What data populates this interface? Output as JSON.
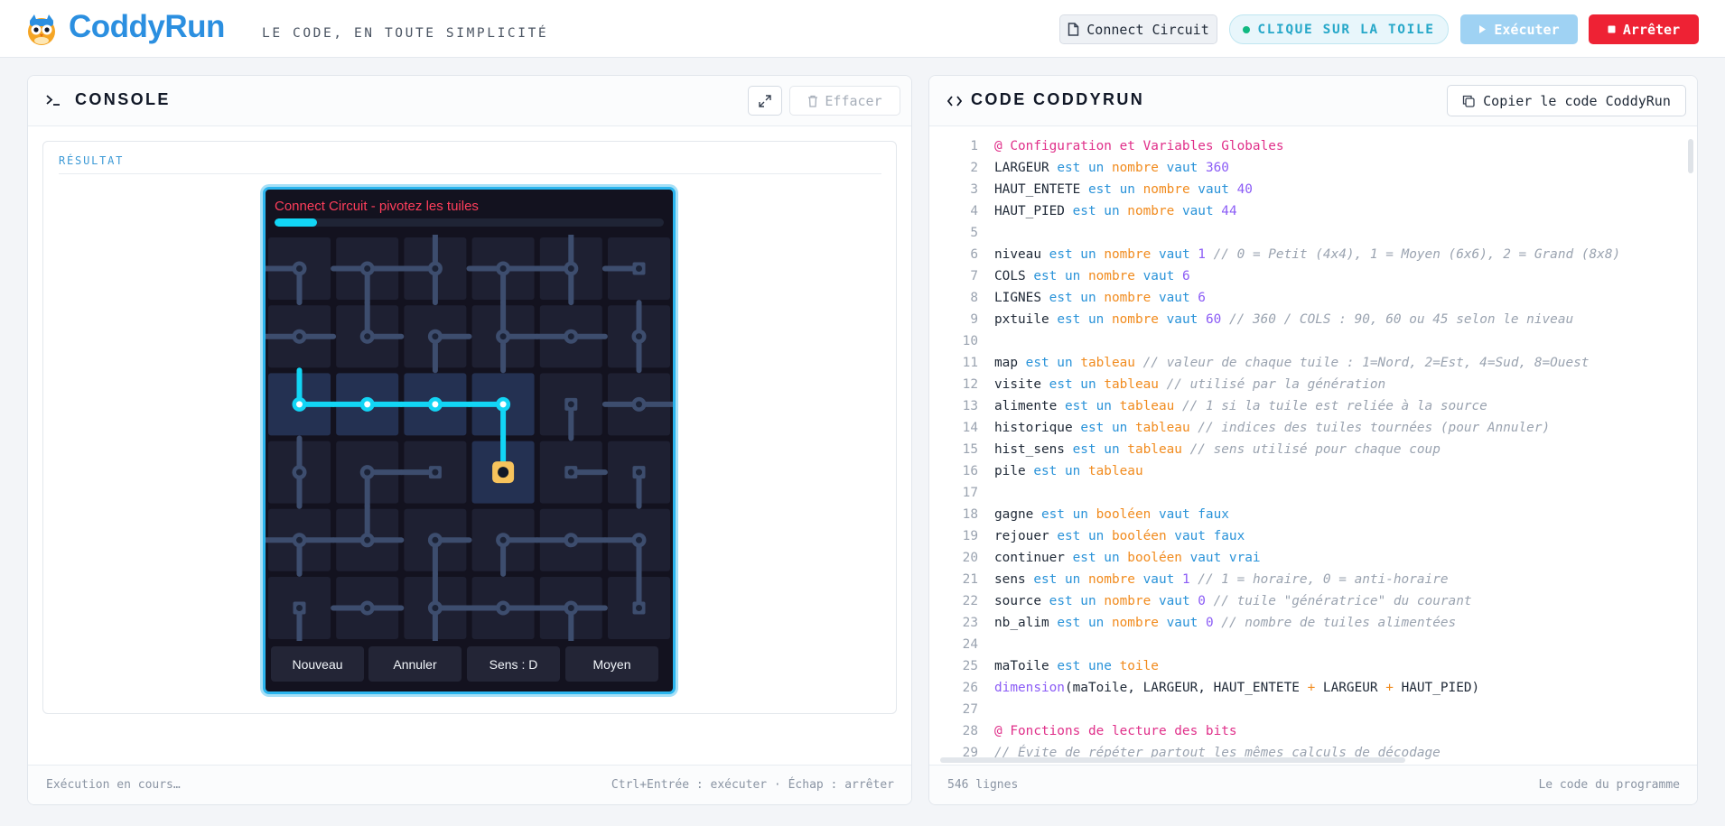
{
  "header": {
    "brand": "CoddyRun",
    "tagline": "LE CODE, EN TOUTE SIMPLICITÉ",
    "file_button": "Connect Circuit",
    "status": "CLIQUE SUR LA TOILE",
    "run_button": "Exécuter",
    "stop_button": "Arrêter",
    "colors": {
      "brand": "#2b8fe0",
      "run": "#9fd2f3",
      "stop": "#ee2234",
      "status": "#27a8c9"
    }
  },
  "console": {
    "title": "CONSOLE",
    "clear_button": "Effacer",
    "result_label": "RÉSULTAT",
    "footer_status": "Exécution en cours…",
    "footer_shortcuts": "Ctrl+Entrée : exécuter · Échap : arrêter"
  },
  "game": {
    "title": "Connect Circuit - pivotez les tuiles",
    "progress": 0.11,
    "cols": 6,
    "rows": 6,
    "tiles": [
      [
        12,
        14,
        13,
        14,
        13,
        8
      ],
      [
        10,
        3,
        6,
        7,
        10,
        5
      ],
      [
        3,
        10,
        10,
        12,
        4,
        10
      ],
      [
        5,
        6,
        8,
        1,
        2,
        4
      ],
      [
        14,
        11,
        6,
        6,
        10,
        12
      ],
      [
        4,
        10,
        7,
        10,
        14,
        1
      ]
    ],
    "powered": [
      [
        0,
        0,
        0,
        0,
        0,
        0
      ],
      [
        0,
        0,
        0,
        0,
        0,
        0
      ],
      [
        1,
        1,
        1,
        1,
        0,
        0
      ],
      [
        0,
        0,
        0,
        1,
        0,
        0
      ],
      [
        0,
        0,
        0,
        0,
        0,
        0
      ],
      [
        0,
        0,
        0,
        0,
        0,
        0
      ]
    ],
    "source": [
      3,
      3
    ],
    "buttons": [
      "Nouveau",
      "Annuler",
      "Sens : D",
      "Moyen"
    ],
    "colors": {
      "bg": "#13121f",
      "tile": "#1e2032",
      "tile_powered": "#243152",
      "pipe": "#3d4d6e",
      "pipe_powered": "#12d5f5",
      "source": "#f7c35c",
      "title": "#ff3e5b"
    }
  },
  "code": {
    "title": "CODE CODDYRUN",
    "copy_button": "Copier le code CoddyRun",
    "footer_lines": "546 lignes",
    "footer_label": "Le code du programme",
    "lines": [
      [
        [
          "hdr",
          "@ Configuration et Variables Globales"
        ]
      ],
      [
        [
          "t",
          "LARGEUR "
        ],
        [
          "kw",
          "est un "
        ],
        [
          "type",
          "nombre "
        ],
        [
          "kw",
          "vaut "
        ],
        [
          "num",
          "360"
        ]
      ],
      [
        [
          "t",
          "HAUT_ENTETE "
        ],
        [
          "kw",
          "est un "
        ],
        [
          "type",
          "nombre "
        ],
        [
          "kw",
          "vaut "
        ],
        [
          "num",
          "40"
        ]
      ],
      [
        [
          "t",
          "HAUT_PIED "
        ],
        [
          "kw",
          "est un "
        ],
        [
          "type",
          "nombre "
        ],
        [
          "kw",
          "vaut "
        ],
        [
          "num",
          "44"
        ]
      ],
      [],
      [
        [
          "t",
          "niveau "
        ],
        [
          "kw",
          "est un "
        ],
        [
          "type",
          "nombre "
        ],
        [
          "kw",
          "vaut "
        ],
        [
          "num",
          "1 "
        ],
        [
          "cmt",
          "// 0 = Petit (4x4), 1 = Moyen (6x6), 2 = Grand (8x8)"
        ]
      ],
      [
        [
          "t",
          "COLS "
        ],
        [
          "kw",
          "est un "
        ],
        [
          "type",
          "nombre "
        ],
        [
          "kw",
          "vaut "
        ],
        [
          "num",
          "6"
        ]
      ],
      [
        [
          "t",
          "LIGNES "
        ],
        [
          "kw",
          "est un "
        ],
        [
          "type",
          "nombre "
        ],
        [
          "kw",
          "vaut "
        ],
        [
          "num",
          "6"
        ]
      ],
      [
        [
          "t",
          "pxtuile "
        ],
        [
          "kw",
          "est un "
        ],
        [
          "type",
          "nombre "
        ],
        [
          "kw",
          "vaut "
        ],
        [
          "num",
          "60 "
        ],
        [
          "cmt",
          "// 360 / COLS : 90, 60 ou 45 selon le niveau"
        ]
      ],
      [],
      [
        [
          "t",
          "map "
        ],
        [
          "kw",
          "est un "
        ],
        [
          "type",
          "tableau "
        ],
        [
          "cmt",
          "// valeur de chaque tuile : 1=Nord, 2=Est, 4=Sud, 8=Ouest"
        ]
      ],
      [
        [
          "t",
          "visite "
        ],
        [
          "kw",
          "est un "
        ],
        [
          "type",
          "tableau "
        ],
        [
          "cmt",
          "// utilisé par la génération"
        ]
      ],
      [
        [
          "t",
          "alimente "
        ],
        [
          "kw",
          "est un "
        ],
        [
          "type",
          "tableau "
        ],
        [
          "cmt",
          "// 1 si la tuile est reliée à la source"
        ]
      ],
      [
        [
          "t",
          "historique "
        ],
        [
          "kw",
          "est un "
        ],
        [
          "type",
          "tableau "
        ],
        [
          "cmt",
          "// indices des tuiles tournées (pour Annuler)"
        ]
      ],
      [
        [
          "t",
          "hist_sens "
        ],
        [
          "kw",
          "est un "
        ],
        [
          "type",
          "tableau "
        ],
        [
          "cmt",
          "// sens utilisé pour chaque coup"
        ]
      ],
      [
        [
          "t",
          "pile "
        ],
        [
          "kw",
          "est un "
        ],
        [
          "type",
          "tableau"
        ]
      ],
      [],
      [
        [
          "t",
          "gagne "
        ],
        [
          "kw",
          "est un "
        ],
        [
          "type",
          "booléen "
        ],
        [
          "kw",
          "vaut faux"
        ]
      ],
      [
        [
          "t",
          "rejouer "
        ],
        [
          "kw",
          "est un "
        ],
        [
          "type",
          "booléen "
        ],
        [
          "kw",
          "vaut faux"
        ]
      ],
      [
        [
          "t",
          "continuer "
        ],
        [
          "kw",
          "est un "
        ],
        [
          "type",
          "booléen "
        ],
        [
          "kw",
          "vaut vrai"
        ]
      ],
      [
        [
          "t",
          "sens "
        ],
        [
          "kw",
          "est un "
        ],
        [
          "type",
          "nombre "
        ],
        [
          "kw",
          "vaut "
        ],
        [
          "num",
          "1 "
        ],
        [
          "cmt",
          "// 1 = horaire, 0 = anti-horaire"
        ]
      ],
      [
        [
          "t",
          "source "
        ],
        [
          "kw",
          "est un "
        ],
        [
          "type",
          "nombre "
        ],
        [
          "kw",
          "vaut "
        ],
        [
          "num",
          "0 "
        ],
        [
          "cmt",
          "// tuile \"génératrice\" du courant"
        ]
      ],
      [
        [
          "t",
          "nb_alim "
        ],
        [
          "kw",
          "est un "
        ],
        [
          "type",
          "nombre "
        ],
        [
          "kw",
          "vaut "
        ],
        [
          "num",
          "0 "
        ],
        [
          "cmt",
          "// nombre de tuiles alimentées"
        ]
      ],
      [],
      [
        [
          "t",
          "maToile "
        ],
        [
          "kw",
          "est une "
        ],
        [
          "type",
          "toile"
        ]
      ],
      [
        [
          "fn",
          "dimension"
        ],
        [
          "t",
          "(maToile, LARGEUR, HAUT_ENTETE "
        ],
        [
          "op",
          "+"
        ],
        [
          "t",
          " LARGEUR "
        ],
        [
          "op",
          "+"
        ],
        [
          "t",
          " HAUT_PIED)"
        ]
      ],
      [],
      [
        [
          "hdr",
          "@ Fonctions de lecture des bits"
        ]
      ],
      [
        [
          "cmt",
          "// Évite de répéter partout les mêmes calculs de décodage"
        ]
      ]
    ]
  }
}
